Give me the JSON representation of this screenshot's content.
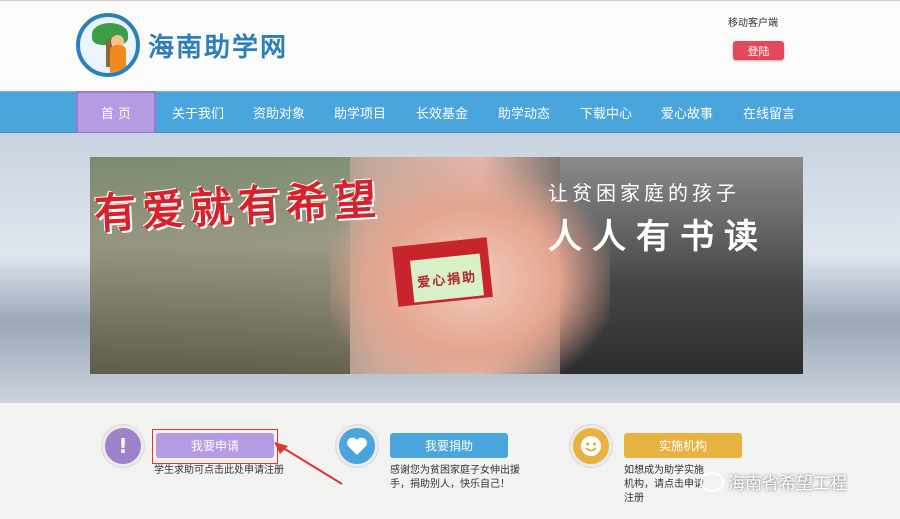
{
  "site": {
    "logo_text": "海南助学网",
    "mobile_link": "移动客户端",
    "login_label": "登陆"
  },
  "nav": {
    "items": [
      {
        "label": "首 页",
        "active": true
      },
      {
        "label": "关于我们"
      },
      {
        "label": "资助对象"
      },
      {
        "label": "助学项目"
      },
      {
        "label": "长效基金"
      },
      {
        "label": "助学动态"
      },
      {
        "label": "下载中心"
      },
      {
        "label": "爱心故事"
      },
      {
        "label": "在线留言"
      }
    ]
  },
  "banner": {
    "slogan_red": "有爱就有希望",
    "slogan_sub": "让贫困家庭的孩子",
    "slogan_big": "人人有书读",
    "box_text": "爱心捐助"
  },
  "actions": [
    {
      "label": "我要申请",
      "desc": "学生求助可点击此处申请注册",
      "color": "#b69ae2",
      "icon_color": "#9f82c9",
      "icon": "exclamation-icon"
    },
    {
      "label": "我要捐助",
      "desc": "感谢您为贫困家庭子女伸出援手，捐助别人，快乐自己！",
      "color": "#49a5dc",
      "icon_color": "#49a5dc",
      "icon": "heart-icon"
    },
    {
      "label": "实施机构",
      "desc": "如想成为助学实施机构，请点击申请注册",
      "color": "#e7b240",
      "icon_color": "#e7b240",
      "icon": "smiley-icon"
    }
  ],
  "watermark": "海南省希望工程",
  "colors": {
    "nav_bg": "#49a5dc",
    "active_nav": "#b69ae2",
    "login_btn": "#e24a5c",
    "annotation_red": "#e0362c"
  }
}
